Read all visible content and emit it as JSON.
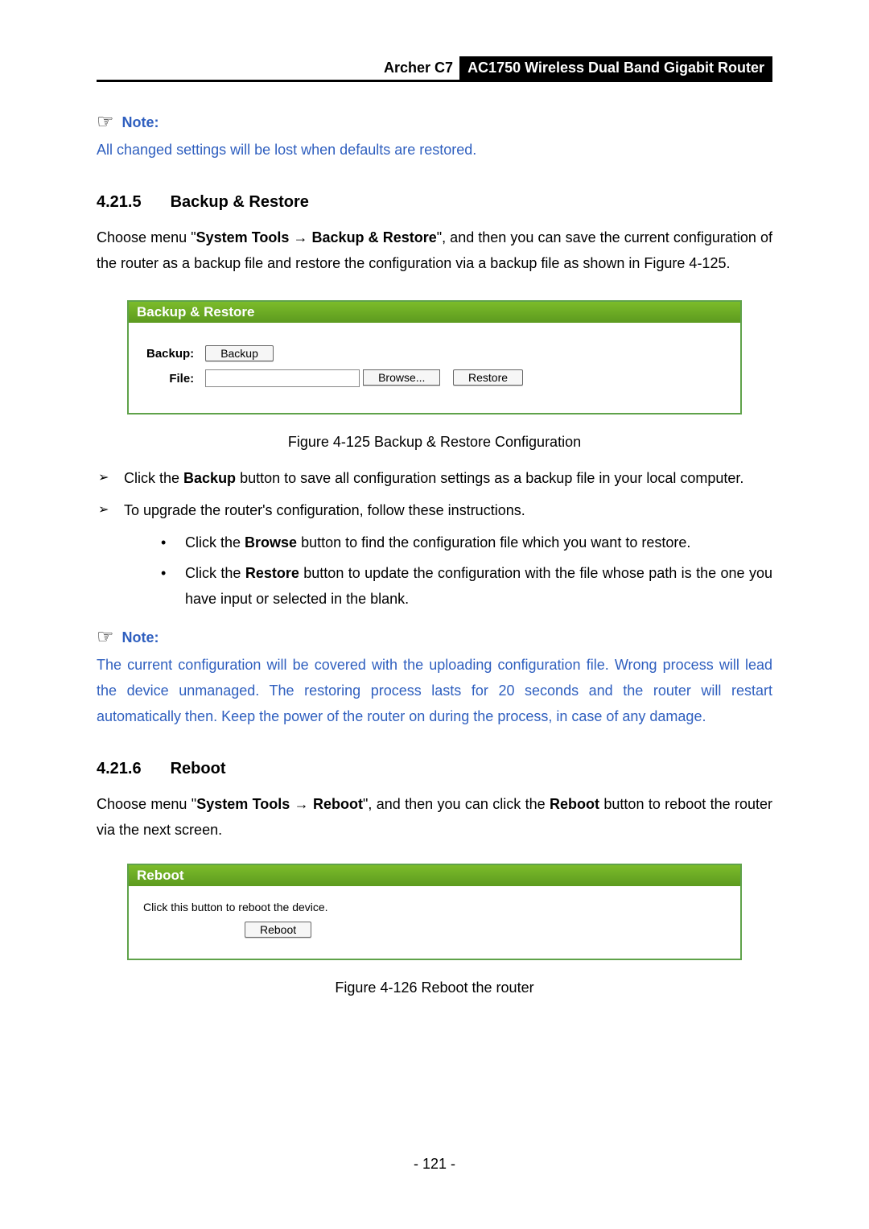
{
  "header": {
    "model": "Archer C7",
    "product": "AC1750 Wireless Dual Band Gigabit Router"
  },
  "note1": {
    "label": "Note:",
    "body": "All changed settings will be lost when defaults are restored."
  },
  "section1": {
    "num": "4.21.5",
    "title": "Backup & Restore",
    "para_pre": "Choose menu \"",
    "para_bold1": "System Tools",
    "para_mid": " → ",
    "para_bold2": "Backup & Restore",
    "para_post": "\", and then you can save the current configuration of the router as a backup file and restore the configuration via a backup file as shown in Figure 4-125."
  },
  "figure1": {
    "panel_title": "Backup & Restore",
    "backup_label": "Backup:",
    "file_label": "File:",
    "backup_btn": "Backup",
    "browse_btn": "Browse...",
    "restore_btn": "Restore",
    "caption": "Figure 4-125 Backup & Restore Configuration"
  },
  "list1": {
    "item1_pre": "Click the ",
    "item1_bold": "Backup",
    "item1_post": " button to save all configuration settings as a backup file in your local computer.",
    "item2": "To upgrade the router's configuration, follow these instructions.",
    "sub1_pre": "Click the ",
    "sub1_bold": "Browse",
    "sub1_post": " button to find the configuration file which you want to restore.",
    "sub2_pre": "Click the ",
    "sub2_bold": "Restore",
    "sub2_post": " button to update the configuration with the file whose path is the one you have input or selected in the blank."
  },
  "note2": {
    "label": "Note:",
    "body": "The current configuration will be covered with the uploading configuration file. Wrong process will lead the device unmanaged. The restoring process lasts for 20 seconds and the router will restart automatically then. Keep the power of the router on during the process, in case of any damage."
  },
  "section2": {
    "num": "4.21.6",
    "title": "Reboot",
    "para_pre": "Choose menu \"",
    "para_bold1": "System Tools",
    "para_mid": " → ",
    "para_bold2": "Reboot",
    "para_mid2": "\", and then you can click the ",
    "para_bold3": "Reboot",
    "para_post": " button to reboot the router via the next screen."
  },
  "figure2": {
    "panel_title": "Reboot",
    "hint": "Click this button to reboot the device.",
    "reboot_btn": "Reboot",
    "caption": "Figure 4-126 Reboot the router"
  },
  "page_number": "- 121 -"
}
